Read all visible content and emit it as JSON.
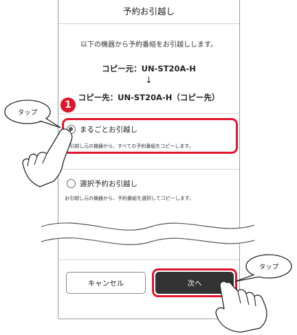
{
  "dialog": {
    "title": "予約お引越し",
    "intro": "以下の機器から予約番組をお引越しします。",
    "copy_source": "コピー元：UN-ST20A-H",
    "arrow": "↓",
    "copy_destination": "コピー先：UN-ST20A-H（コピー先）"
  },
  "options": [
    {
      "label": "まるごとお引越し",
      "description": "お引越し元の機器から、すべての予約番組をコピーします。",
      "selected": true
    },
    {
      "label": "選択予約お引越し",
      "description": "お引越し元の機器から、予約番組を選択してコピーします。",
      "selected": false
    }
  ],
  "buttons": {
    "cancel": "キャンセル",
    "next": "次へ"
  },
  "annotations": {
    "tap_left": "タップ",
    "tap_right": "タップ",
    "step_number": "1",
    "highlight_color": "#e0142b"
  }
}
